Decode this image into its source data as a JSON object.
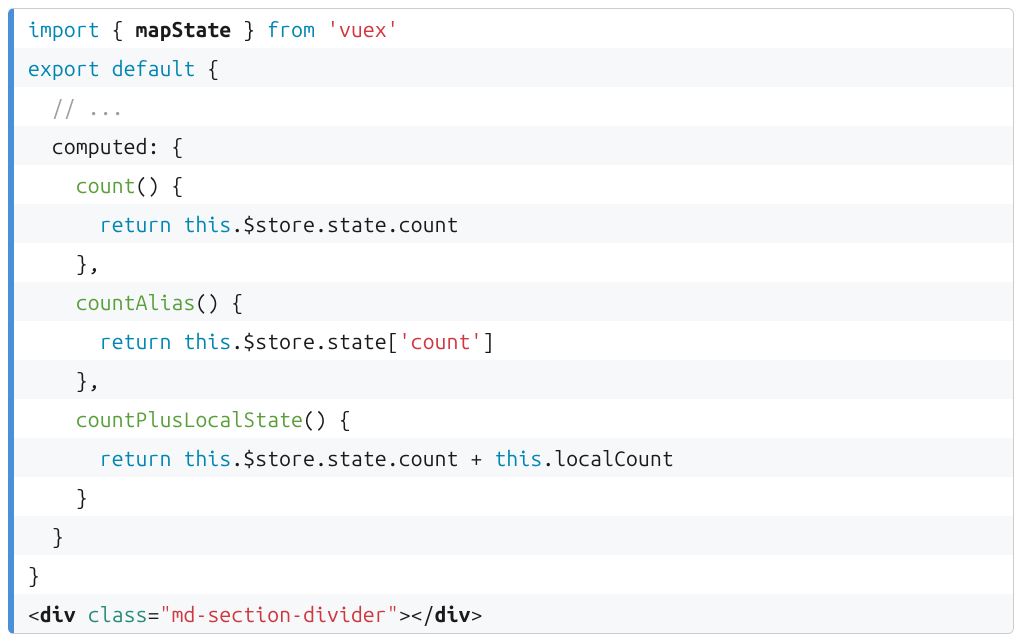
{
  "code": {
    "lines": [
      [
        {
          "cls": "kw",
          "t": "import"
        },
        {
          "cls": "pl",
          "t": " { "
        },
        {
          "cls": "def",
          "t": "mapState"
        },
        {
          "cls": "pl",
          "t": " } "
        },
        {
          "cls": "kw",
          "t": "from"
        },
        {
          "cls": "pl",
          "t": " "
        },
        {
          "cls": "str",
          "t": "'vuex'"
        }
      ],
      [
        {
          "cls": "kw",
          "t": "export"
        },
        {
          "cls": "pl",
          "t": " "
        },
        {
          "cls": "kw",
          "t": "default"
        },
        {
          "cls": "pl",
          "t": " {"
        }
      ],
      [
        {
          "cls": "pl",
          "t": "  "
        },
        {
          "cls": "com",
          "t": "// ..."
        }
      ],
      [
        {
          "cls": "pl",
          "t": "  computed: {"
        }
      ],
      [
        {
          "cls": "pl",
          "t": "    "
        },
        {
          "cls": "fn",
          "t": "count"
        },
        {
          "cls": "pl",
          "t": "() {"
        }
      ],
      [
        {
          "cls": "pl",
          "t": "      "
        },
        {
          "cls": "kw",
          "t": "return"
        },
        {
          "cls": "pl",
          "t": " "
        },
        {
          "cls": "kw",
          "t": "this"
        },
        {
          "cls": "pl",
          "t": ".$store.state.count"
        }
      ],
      [
        {
          "cls": "pl",
          "t": "    },"
        }
      ],
      [
        {
          "cls": "pl",
          "t": "    "
        },
        {
          "cls": "fn",
          "t": "countAlias"
        },
        {
          "cls": "pl",
          "t": "() {"
        }
      ],
      [
        {
          "cls": "pl",
          "t": "      "
        },
        {
          "cls": "kw",
          "t": "return"
        },
        {
          "cls": "pl",
          "t": " "
        },
        {
          "cls": "kw",
          "t": "this"
        },
        {
          "cls": "pl",
          "t": ".$store.state["
        },
        {
          "cls": "str",
          "t": "'count'"
        },
        {
          "cls": "pl",
          "t": "]"
        }
      ],
      [
        {
          "cls": "pl",
          "t": "    },"
        }
      ],
      [
        {
          "cls": "pl",
          "t": "    "
        },
        {
          "cls": "fn",
          "t": "countPlusLocalState"
        },
        {
          "cls": "pl",
          "t": "() {"
        }
      ],
      [
        {
          "cls": "pl",
          "t": "      "
        },
        {
          "cls": "kw",
          "t": "return"
        },
        {
          "cls": "pl",
          "t": " "
        },
        {
          "cls": "kw",
          "t": "this"
        },
        {
          "cls": "pl",
          "t": ".$store.state.count + "
        },
        {
          "cls": "kw",
          "t": "this"
        },
        {
          "cls": "pl",
          "t": ".localCount"
        }
      ],
      [
        {
          "cls": "pl",
          "t": "    }"
        }
      ],
      [
        {
          "cls": "pl",
          "t": "  }"
        }
      ],
      [
        {
          "cls": "pl",
          "t": "}"
        }
      ],
      [
        {
          "cls": "pl",
          "t": "<"
        },
        {
          "cls": "def",
          "t": "div"
        },
        {
          "cls": "pl",
          "t": " "
        },
        {
          "cls": "attr",
          "t": "class"
        },
        {
          "cls": "pl",
          "t": "="
        },
        {
          "cls": "str",
          "t": "\"md-section-divider\""
        },
        {
          "cls": "pl",
          "t": "></"
        },
        {
          "cls": "def",
          "t": "div"
        },
        {
          "cls": "pl",
          "t": ">"
        }
      ]
    ]
  }
}
